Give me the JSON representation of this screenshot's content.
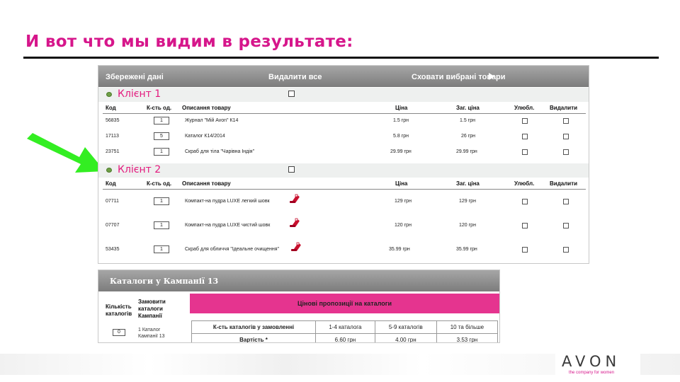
{
  "slide": {
    "title": "И вот что мы видим в результате:"
  },
  "saved": {
    "title": "Збережені дані",
    "delete_all": "Видалити все",
    "hide_selected": "Сховати вибрані товари",
    "headers": [
      "Код",
      "К-сть од.",
      "Описання товару",
      "Ціна",
      "Заг. ціна",
      "Улюбл.",
      "Видалити"
    ],
    "clients": [
      {
        "name": "Клієнт 1",
        "rows": [
          {
            "code": "56835",
            "qty": "1",
            "desc": "Журнал \"Мій Avon\" К14",
            "price": "1.5 грн",
            "total": "1.5 грн"
          },
          {
            "code": "17113",
            "qty": "5",
            "desc": "Каталог К14/2014",
            "price": "5.8 грн",
            "total": "26 грн"
          },
          {
            "code": "23751",
            "qty": "1",
            "desc": "Скраб для тіла \"Чарівна Індія\"",
            "price": "29.99 грн",
            "total": "29.99 грн"
          }
        ]
      },
      {
        "name": "Клієнт 2",
        "rows": [
          {
            "code": "07711",
            "qty": "1",
            "desc": "Компакт-на пудра LUXE легкий шовк",
            "price": "129 грн",
            "total": "129 грн"
          },
          {
            "code": "07707",
            "qty": "1",
            "desc": "Компакт-на пудра LUXE чистий шовк",
            "price": "120 грн",
            "total": "120 грн"
          },
          {
            "code": "53435",
            "qty": "1",
            "desc": "Скраб для обличчя \"Ідеальне очищення\"",
            "price": "35.99 грн",
            "total": "35.99 грн"
          }
        ]
      }
    ]
  },
  "catalogs": {
    "title": "Каталоги у Кампанії 13",
    "qty_label_1": "Кількість",
    "qty_label_2": "каталогів",
    "order_label_1": "Замовити",
    "order_label_2": "каталоги",
    "order_label_3": "Кампанії",
    "item_line_1": "1 Каталог",
    "item_line_2": "Кампанії 13",
    "qty_value": "0",
    "offers_title": "Цінові пропозиції на каталоги",
    "row1_label": "К-сть каталогів у замовленні",
    "row1": [
      "1-4 каталога",
      "5-9 каталогів",
      "10 та більше"
    ],
    "row2_label": "Вартість *",
    "row2": [
      "6.60 грн",
      "4.00 грн",
      "3.53 грн"
    ]
  },
  "brand": {
    "logo": "AVON",
    "tagline": "the company for women"
  },
  "colors": {
    "accent": "#d6168b",
    "client_text": "#e3197d",
    "pink_bar": "#e5348f",
    "arrow": "#33ee22"
  }
}
